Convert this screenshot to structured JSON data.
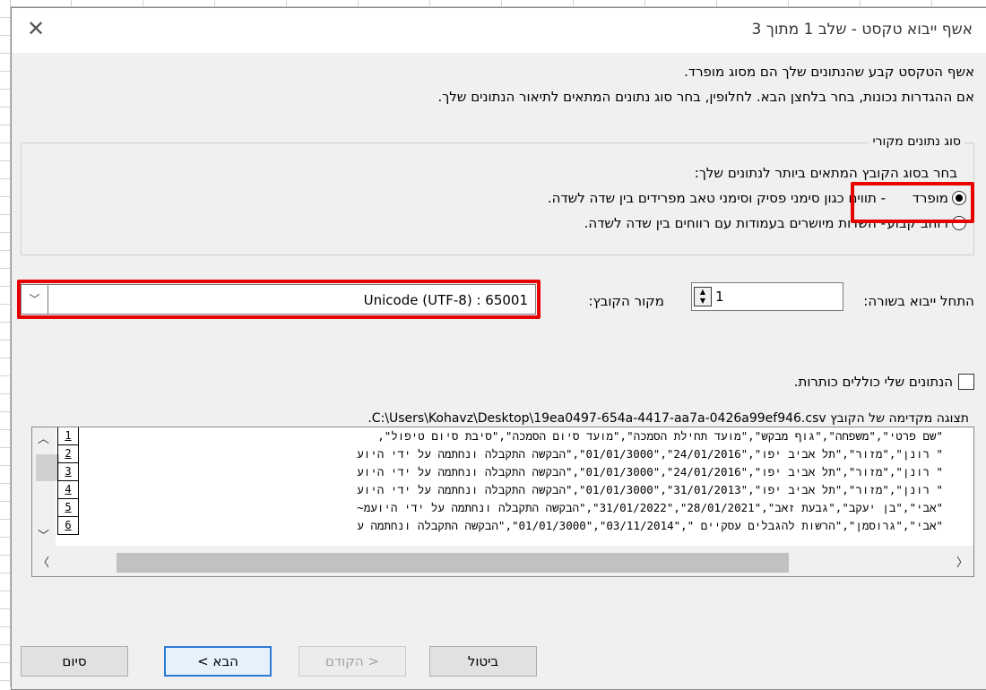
{
  "window": {
    "title": "אשף ייבוא טקסט - שלב 1 מתוך 3",
    "close_icon": "close-icon"
  },
  "intro": {
    "line1": "אשף הטקסט קבע שהנתונים שלך הם מסוג מופרד.",
    "line2": "אם ההגדרות נכונות, בחר בלחצן הבא. לחלופין, בחר סוג נתונים המתאים לתיאור הנתונים שלך."
  },
  "original_data_type": {
    "legend": "סוג נתונים מקורי",
    "prompt": "בחר בסוג הקובץ המתאים ביותר לנתונים שלך:",
    "options": [
      {
        "label": "מופרד",
        "description": "- תווים כגון סימני פסיק וסימני טאב מפרידים בין שדה לשדה.",
        "selected": true
      },
      {
        "label": "רוחב קבוע",
        "description": "- השדות מיושרים בעמודות עם רווחים בין שדה לשדה.",
        "selected": false
      }
    ]
  },
  "import_start": {
    "label": "התחל ייבוא בשורה:",
    "value": "1"
  },
  "file_origin": {
    "label": "מקור הקובץ:",
    "value": "Unicode (UTF-8) : 65001"
  },
  "headers_checkbox": {
    "label": "הנתונים שלי כוללים כותרות.",
    "checked": false
  },
  "preview": {
    "label": "תצוגה מקדימה של הקובץ C:\\Users\\Kohavz\\Desktop\\19ea0497-654a-4417-aa7a-0426a99ef946.csv.",
    "rows": [
      {
        "num": "1",
        "text": "\"שם פרטי\",\"משפחה\",\"גוף מבקש\",\"מועד תחילת הסמכה\",\"מועד סיום הסמכה\",\"סיבת סיום טיפול\","
      },
      {
        "num": "2",
        "text": "\" רונן\",\"מזור\",\"תל אביב יפו\",\"24/01/2016\",\"01/01/3000\",\"הבקשה התקבלה ונחתמה על ידי היוע"
      },
      {
        "num": "3",
        "text": "\" רונן\",\"מזור\",\"תל אביב יפו\",\"24/01/2016\",\"01/01/3000\",\"הבקשה התקבלה ונחתמה על ידי היוע"
      },
      {
        "num": "4",
        "text": "\" רונן\",\"מזור\",\"תל אביב יפו\",\"31/01/2013\",\"01/01/3000\",\"הבקשה התקבלה ונחתמה על ידי היוע"
      },
      {
        "num": "5",
        "text": "\"אבי\",\"בן יעקב\",\"גבעת זאב\",\"28/01/2021\",\"31/01/2022\",\"הבקשה התקבלה ונחתמה על ידי היועמ~"
      },
      {
        "num": "6",
        "text": "\"אבי\",\"גרוסמן\",\"הרשות להגבלים עסקיים \",\"03/11/2014\",\"01/01/3000\",\"הבקשה התקבלה ונחתמה ע"
      }
    ]
  },
  "buttons": {
    "cancel": "ביטול",
    "back": "< הקודם",
    "next": "הבא >",
    "finish": "סיום"
  },
  "colors": {
    "highlight": "#e60000",
    "primary_border": "#2a7ad5"
  }
}
